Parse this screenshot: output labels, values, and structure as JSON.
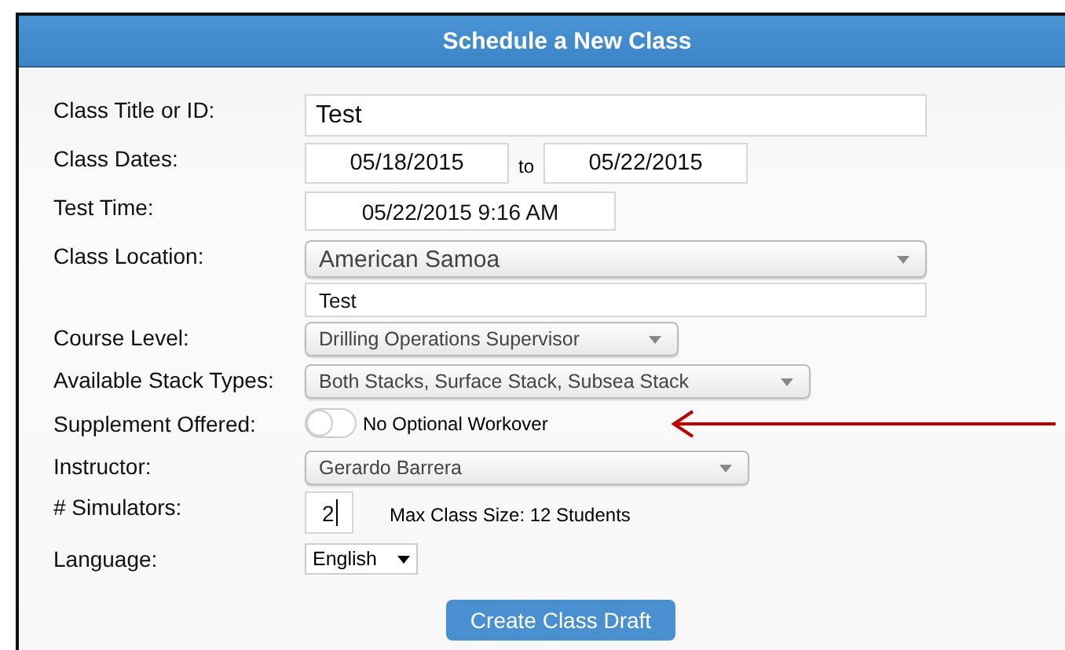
{
  "panel": {
    "title": "Schedule a New Class"
  },
  "fields": [
    {
      "kind": "text",
      "label": "Class Title or ID:",
      "value": "Test"
    },
    {
      "kind": "daterange",
      "label": "Class Dates:",
      "from": "05/18/2015",
      "separator": "to",
      "to": "05/22/2015"
    },
    {
      "kind": "datetime",
      "label": "Test Time:",
      "value": "05/22/2015 9:16 AM"
    },
    {
      "kind": "location",
      "label": "Class Location:",
      "value": "American Samoa",
      "detail": "Test"
    },
    {
      "kind": "select",
      "label": "Course Level:",
      "value": "Drilling Operations Supervisor"
    },
    {
      "kind": "select",
      "label": "Available Stack Types:",
      "value": "Both Stacks, Surface Stack, Subsea Stack"
    },
    {
      "kind": "toggle",
      "label": "Supplement Offered:",
      "on": false,
      "caption": "No Optional Workover",
      "pointer": true
    },
    {
      "kind": "select",
      "label": "Instructor:",
      "value": "Gerardo Barrera"
    },
    {
      "kind": "number",
      "label": "# Simulators:",
      "value": "2",
      "note": "Max Class Size: 12 Students"
    },
    {
      "kind": "dropdown",
      "label": "Language:",
      "value": "English"
    }
  ],
  "submit_button": "Create Class Draft"
}
